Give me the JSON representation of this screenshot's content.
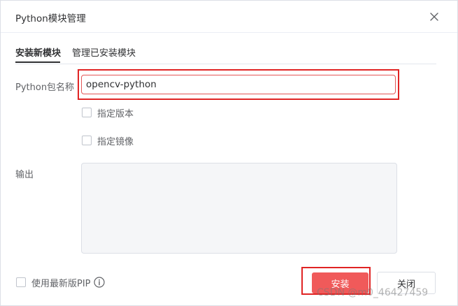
{
  "dialog": {
    "title": "Python模块管理",
    "close_icon": "close-icon"
  },
  "tabs": [
    {
      "label": "安装新模块",
      "active": true
    },
    {
      "label": "管理已安装模块",
      "active": false
    }
  ],
  "form": {
    "package_label": "Python包名称",
    "package_value": "opencv-python",
    "specify_version_label": "指定版本",
    "specify_version_checked": false,
    "specify_mirror_label": "指定镜像",
    "specify_mirror_checked": false,
    "output_label": "输出",
    "output_text": ""
  },
  "footer": {
    "latest_pip_label": "使用最新版PIP",
    "latest_pip_checked": false,
    "info_icon": "info-icon",
    "install_label": "安装",
    "close_label": "关闭"
  },
  "watermark": "CSDN @m0_46427459",
  "colors": {
    "primary_button": "#f05a5a",
    "highlight_border": "#e02424",
    "output_background": "#f5f6f8"
  }
}
